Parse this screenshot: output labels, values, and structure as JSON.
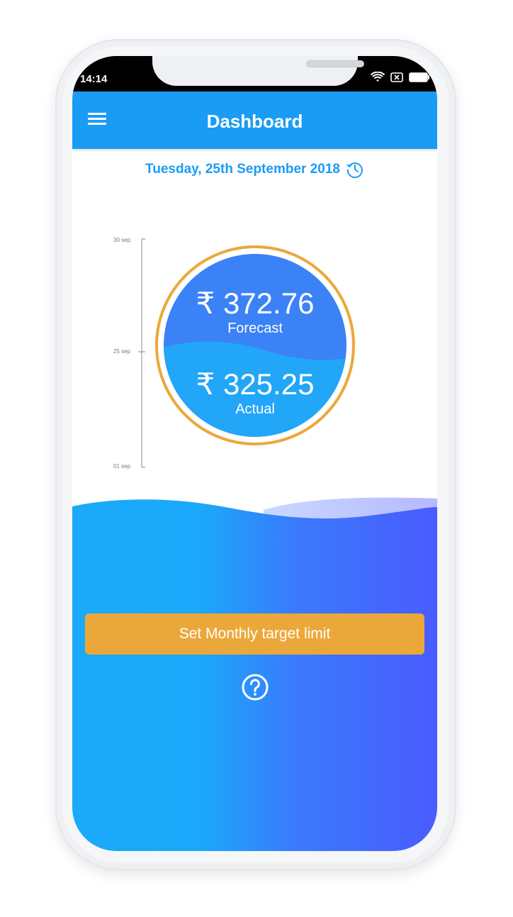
{
  "status_bar": {
    "time": "14:14",
    "icons": [
      "wifi-icon",
      "no-sim-icon",
      "battery-icon"
    ]
  },
  "header": {
    "title": "Dashboard",
    "menu_icon": "hamburger-menu-icon"
  },
  "date": {
    "text": "Tuesday, 25th September 2018",
    "icon": "history-clock-icon"
  },
  "timeline": {
    "labels": [
      "30 sep",
      "25 sep",
      "01 sep"
    ],
    "current_day": 25
  },
  "gauge": {
    "currency_symbol": "₹",
    "forecast_value": "372.76",
    "forecast_label": "Forecast",
    "actual_value": "325.25",
    "actual_label": "Actual"
  },
  "actions": {
    "target_button_label": "Set Monthly target limit",
    "help_icon": "help-circle-icon"
  },
  "colors": {
    "primary": "#1a9cf5",
    "accent": "#eba83a",
    "forecast_fill": "#3b82f6",
    "actual_fill": "#22a6f8",
    "gradient_start": "#1aaaf9",
    "gradient_end": "#4a5cff"
  }
}
